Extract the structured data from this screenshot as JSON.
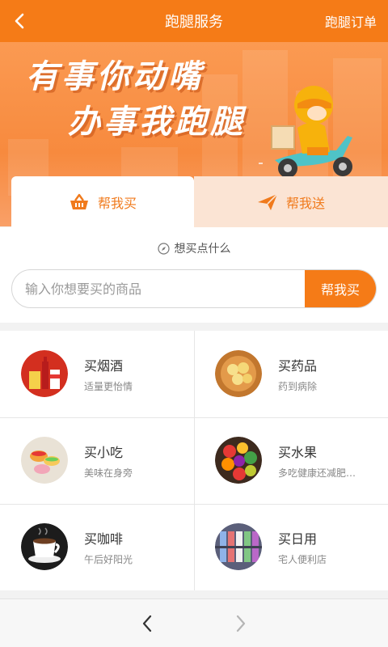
{
  "header": {
    "title": "跑腿服务",
    "orders_label": "跑腿订单",
    "back_icon": "chevron-left-icon"
  },
  "banner": {
    "line1": "有事你动嘴",
    "line2": "办事我跑腿"
  },
  "tabs": [
    {
      "label": "帮我买",
      "icon": "basket-icon",
      "active": true
    },
    {
      "label": "帮我送",
      "icon": "paper-plane-icon",
      "active": false
    }
  ],
  "search": {
    "hint": "想买点什么",
    "placeholder": "输入你想要买的商品",
    "button_label": "帮我买"
  },
  "categories": [
    {
      "name": "买烟酒",
      "desc": "适量更怡情"
    },
    {
      "name": "买药品",
      "desc": "药到病除"
    },
    {
      "name": "买小吃",
      "desc": "美味在身旁"
    },
    {
      "name": "买水果",
      "desc": "多吃健康还减肥…"
    },
    {
      "name": "买咖啡",
      "desc": "午后好阳光"
    },
    {
      "name": "买日用",
      "desc": "宅人便利店"
    }
  ],
  "colors": {
    "accent": "#f57b17",
    "tab_inactive_bg": "#fbe4d4"
  },
  "bottom_nav": {
    "back_icon": "chevron-left-icon",
    "forward_icon": "chevron-right-icon"
  }
}
